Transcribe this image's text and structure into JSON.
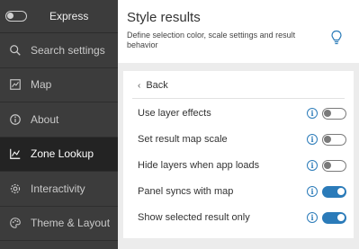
{
  "sidebar": {
    "express_label": "Express",
    "items": [
      {
        "label": "Search settings",
        "icon": "search-icon"
      },
      {
        "label": "Map",
        "icon": "map-icon"
      },
      {
        "label": "About",
        "icon": "info-icon"
      },
      {
        "label": "Zone Lookup",
        "icon": "chart-icon",
        "active": true
      },
      {
        "label": "Interactivity",
        "icon": "gear-icon"
      },
      {
        "label": "Theme & Layout",
        "icon": "palette-icon"
      }
    ]
  },
  "header": {
    "title": "Style results",
    "description": "Define selection color, scale settings and result behavior"
  },
  "panel": {
    "back_label": "Back",
    "settings": [
      {
        "label": "Use layer effects",
        "on": false
      },
      {
        "label": "Set result map scale",
        "on": false
      },
      {
        "label": "Hide layers when app loads",
        "on": false
      },
      {
        "label": "Panel syncs with map",
        "on": true
      },
      {
        "label": "Show selected result only",
        "on": true
      }
    ]
  },
  "colors": {
    "sidebar_bg": "#3c3c3c",
    "sidebar_active_bg": "#232323",
    "accent": "#2b7bb9"
  }
}
